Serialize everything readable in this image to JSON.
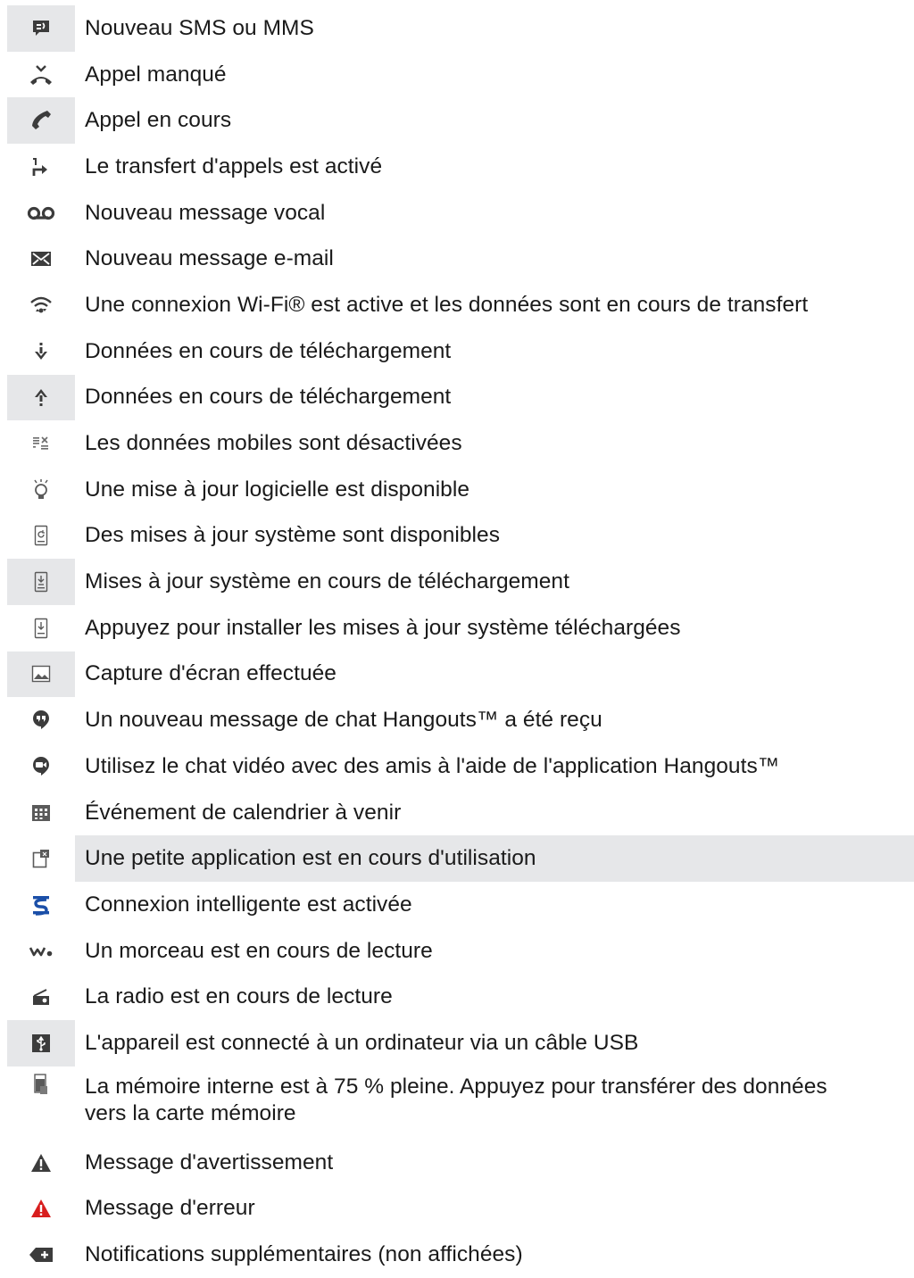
{
  "rows": [
    {
      "icon": "new-message-icon",
      "text": "Nouveau SMS ou MMS"
    },
    {
      "icon": "missed-call-icon",
      "text": "Appel manqué"
    },
    {
      "icon": "ongoing-call-icon",
      "text": "Appel en cours"
    },
    {
      "icon": "call-forward-icon",
      "text": "Le transfert d'appels est activé"
    },
    {
      "icon": "voicemail-icon",
      "text": "Nouveau message vocal"
    },
    {
      "icon": "email-icon",
      "text": "Nouveau message e-mail"
    },
    {
      "icon": "wifi-transfer-icon",
      "text": "Une connexion Wi-Fi® est active et les données sont en cours de transfert"
    },
    {
      "icon": "download-icon",
      "text": "Données en cours de téléchargement"
    },
    {
      "icon": "upload-icon",
      "text": "Données en cours de téléchargement"
    },
    {
      "icon": "mobile-data-off-icon",
      "text": "Les données mobiles sont désactivées"
    },
    {
      "icon": "software-update-icon",
      "text": "Une mise à jour logicielle est disponible"
    },
    {
      "icon": "system-update-icon",
      "text": "Des mises à jour système sont disponibles"
    },
    {
      "icon": "system-update-download-icon",
      "text": "Mises à jour système en cours de téléchargement"
    },
    {
      "icon": "install-update-icon",
      "text": "Appuyez pour installer les mises à jour système téléchargées"
    },
    {
      "icon": "screenshot-icon",
      "text": "Capture d'écran effectuée"
    },
    {
      "icon": "hangouts-icon",
      "text": "Un nouveau message de chat Hangouts™ a été reçu"
    },
    {
      "icon": "hangouts-video-icon",
      "text": "Utilisez le chat vidéo avec des amis à l'aide de l'application Hangouts™"
    },
    {
      "icon": "calendar-icon",
      "text": "Événement de calendrier à venir"
    },
    {
      "icon": "small-app-icon",
      "text": "Une petite application est en cours d'utilisation"
    },
    {
      "icon": "smart-connect-icon",
      "text": "Connexion intelligente est activée"
    },
    {
      "icon": "walkman-icon",
      "text": "Un morceau est en cours de lecture"
    },
    {
      "icon": "radio-icon",
      "text": "La radio est en cours de lecture"
    },
    {
      "icon": "usb-icon",
      "text": "L'appareil est connecté à un ordinateur via un câble USB"
    },
    {
      "icon": "storage-icon",
      "text": "La mémoire interne est à 75 % pleine. Appuyez pour transférer des données vers la carte mémoire"
    },
    {
      "icon": "warning-icon",
      "text": "Message d'avertissement"
    },
    {
      "icon": "error-icon",
      "text": "Message d'erreur"
    },
    {
      "icon": "more-notifications-icon",
      "text": "Notifications supplémentaires (non affichées)"
    }
  ],
  "colors": {
    "shade": "#e6e7e9",
    "icon": "#3c3c3c",
    "error": "#d81e1e",
    "smart_connect": "#1b4fa8"
  }
}
